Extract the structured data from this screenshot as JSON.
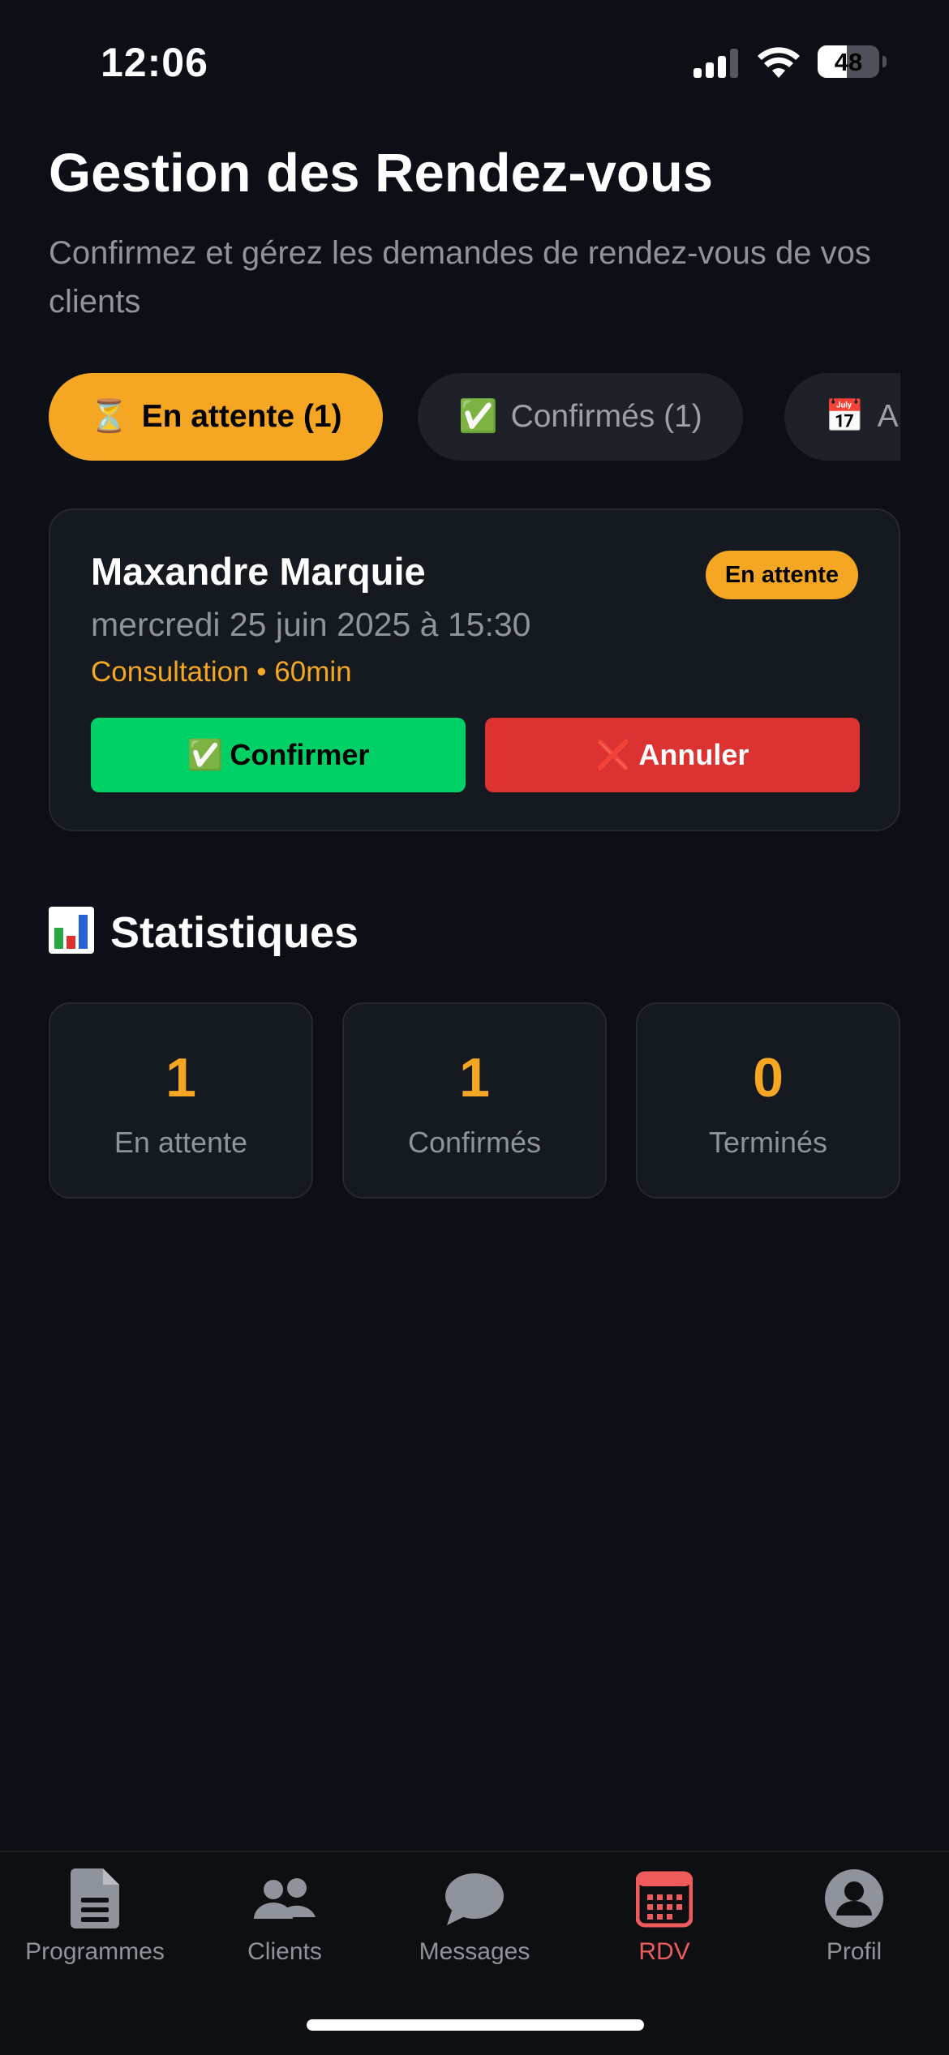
{
  "status_bar": {
    "time": "12:06",
    "battery": "48",
    "battery_level": 0.48
  },
  "header": {
    "title": "Gestion des Rendez-vous",
    "subtitle": "Confirmez et gérez les demandes de rendez-vous de vos clients"
  },
  "filter_tabs": [
    {
      "emoji": "⏳",
      "label": "En attente (1)",
      "active": true
    },
    {
      "emoji": "✅",
      "label": "Confirmés (1)",
      "active": false
    },
    {
      "emoji": "📅",
      "label": "A",
      "active": false
    }
  ],
  "appointment": {
    "client_name": "Maxandre Marquie",
    "status": "En attente",
    "datetime": "mercredi 25 juin 2025 à 15:30",
    "meta": "Consultation • 60min",
    "confirm_emoji": "✅",
    "confirm_label": "Confirmer",
    "cancel_emoji": "❌",
    "cancel_label": "Annuler"
  },
  "stats": {
    "title": "Statistiques",
    "icon": "bar-chart-icon",
    "items": [
      {
        "value": "1",
        "label": "En attente"
      },
      {
        "value": "1",
        "label": "Confirmés"
      },
      {
        "value": "0",
        "label": "Terminés"
      }
    ]
  },
  "tab_bar": {
    "items": [
      {
        "label": "Programmes",
        "icon": "document-icon",
        "active": false
      },
      {
        "label": "Clients",
        "icon": "users-icon",
        "active": false
      },
      {
        "label": "Messages",
        "icon": "chat-bubble-icon",
        "active": false
      },
      {
        "label": "RDV",
        "icon": "calendar-icon",
        "active": true
      },
      {
        "label": "Profil",
        "icon": "profile-icon",
        "active": false
      }
    ]
  },
  "colors": {
    "background": "#0c0f16",
    "accent": "#f5a623",
    "confirm": "#00d166",
    "cancel": "#dc3232",
    "active_tab": "#ef5b5b"
  }
}
